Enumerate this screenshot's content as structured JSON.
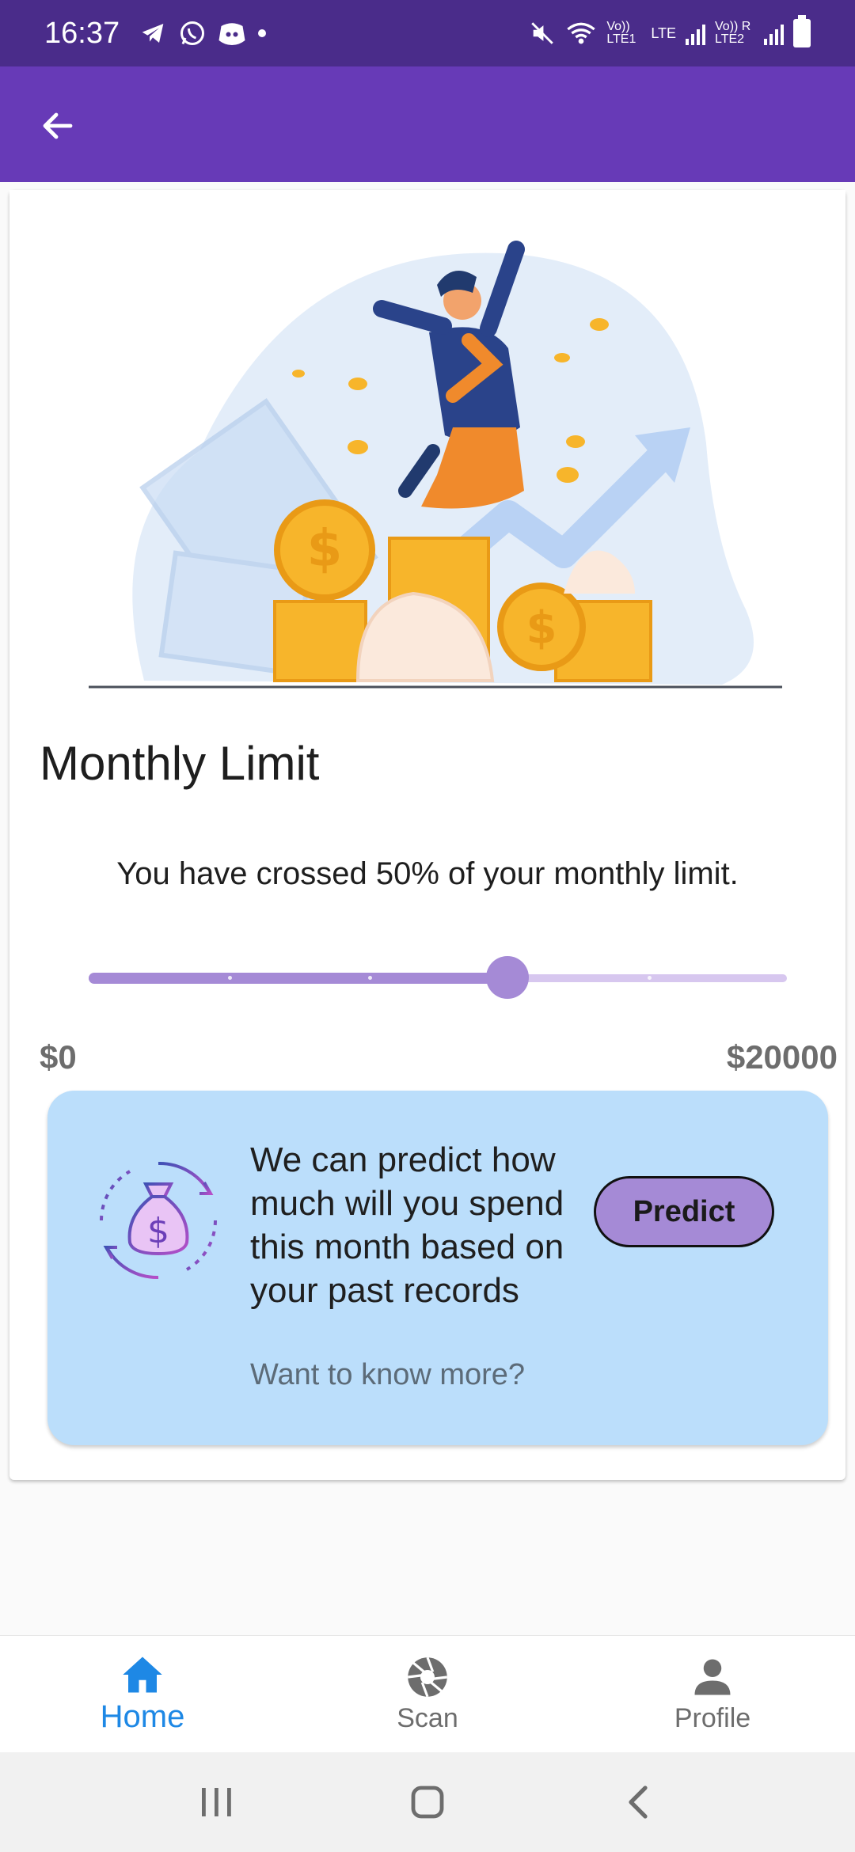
{
  "status_bar": {
    "time": "16:37",
    "left_icons": [
      "telegram-icon",
      "whatsapp-icon",
      "discord-icon",
      "dot-icon"
    ],
    "right_icons": [
      "mute-icon",
      "wifi-icon",
      "lte1-signal-icon",
      "lte2-signal-icon",
      "battery-icon"
    ],
    "sim1_label": "Vo)) LTE1",
    "lte_label": "LTE",
    "sim2_label": "Vo)) R LTE2"
  },
  "app_bar": {
    "back_icon": "arrow-back-icon"
  },
  "card": {
    "title": "Monthly Limit",
    "message": "You have crossed 50% of your monthly limit.",
    "slider": {
      "value_fraction": 0.6,
      "min_label": "$0",
      "max_label": "$20000",
      "divisions": 5
    }
  },
  "predict": {
    "text": "We can predict how much will you spend this month based on your past records",
    "subtext": "Want to know more?",
    "button_label": "Predict",
    "icon": "money-bag-cycle-icon"
  },
  "bottom_nav": {
    "items": [
      {
        "label": "Home",
        "icon": "home-icon",
        "active": true
      },
      {
        "label": "Scan",
        "icon": "camera-shutter-icon",
        "active": false
      },
      {
        "label": "Profile",
        "icon": "person-icon",
        "active": false
      }
    ]
  },
  "colors": {
    "status_bar": "#4a2c8a",
    "app_bar": "#673ab7",
    "slider": "#a58ad6",
    "predict_panel": "#bbdefb",
    "nav_active": "#1e88e5"
  }
}
